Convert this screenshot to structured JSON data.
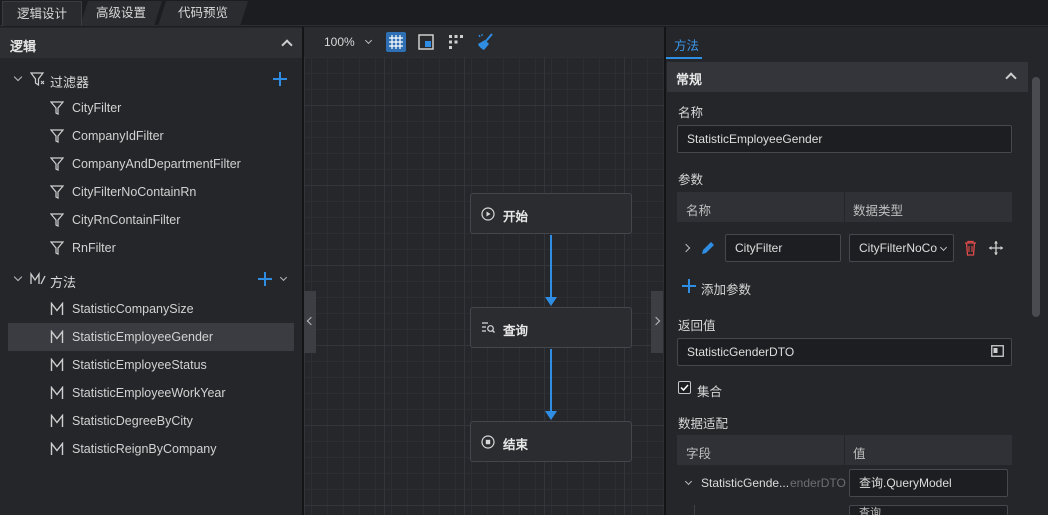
{
  "tabs": [
    {
      "label": "逻辑设计",
      "active": true
    },
    {
      "label": "高级设置",
      "active": false
    },
    {
      "label": "代码预览",
      "active": false
    }
  ],
  "left_panel": {
    "title": "逻辑",
    "filters_group": {
      "label": "过滤器",
      "items": [
        "CityFilter",
        "CompanyIdFilter",
        "CompanyAndDepartmentFilter",
        "CityFilterNoContainRn",
        "CityRnContainFilter",
        "RnFilter"
      ]
    },
    "methods_group": {
      "label": "方法",
      "items": [
        "StatisticCompanySize",
        "StatisticEmployeeGender",
        "StatisticEmployeeStatus",
        "StatisticEmployeeWorkYear",
        "StatisticDegreeByCity",
        "StatisticReignByCompany"
      ],
      "selected": "StatisticEmployeeGender"
    }
  },
  "canvas": {
    "zoom": "100%",
    "nodes": [
      {
        "label": "开始",
        "icon": "play-circle-icon"
      },
      {
        "label": "查询",
        "icon": "query-icon"
      },
      {
        "label": "结束",
        "icon": "stop-circle-icon"
      }
    ]
  },
  "right_panel": {
    "tab": "方法",
    "section_title": "常规",
    "name_label": "名称",
    "name_value": "StatisticEmployeeGender",
    "params_label": "参数",
    "params_headers": [
      "名称",
      "数据类型"
    ],
    "param_row": {
      "name": "CityFilter",
      "type": "CityFilterNoCo"
    },
    "add_param_label": "添加参数",
    "return_label": "返回值",
    "return_value": "StatisticGenderDTO",
    "collection_label": "集合",
    "collection_checked": true,
    "mapping_label": "数据适配",
    "mapping_headers": [
      "字段",
      "值"
    ],
    "mapping_row": {
      "field": "StatisticGende...",
      "field_ghost": "enderDTO",
      "value": "查询.QueryModel"
    },
    "mapping_row2": {
      "value": "查询"
    }
  },
  "colors": {
    "accent": "#2f8de4",
    "danger": "#e04b4b"
  }
}
